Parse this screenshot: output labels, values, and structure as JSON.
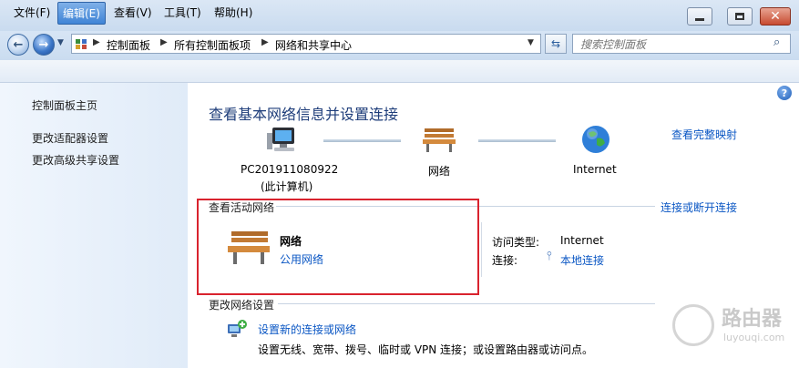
{
  "window": {
    "minimize_icon": "minimize-icon",
    "maximize_icon": "maximize-icon",
    "close_icon": "close-icon"
  },
  "address_bar": {
    "crumbs": [
      "控制面板",
      "所有控制面板项",
      "网络和共享中心"
    ]
  },
  "search": {
    "placeholder": "搜索控制面板"
  },
  "menu": [
    "文件(F)",
    "编辑(E)",
    "查看(V)",
    "工具(T)",
    "帮助(H)"
  ],
  "sidebar": {
    "items": [
      "控制面板主页",
      "更改适配器设置",
      "更改高级共享设置"
    ]
  },
  "main": {
    "title": "查看基本网络信息并设置连接",
    "view_full_map": "查看完整映射",
    "map": {
      "computer_name": "PC201911080922",
      "computer_note": "(此计算机)",
      "network": "网络",
      "internet": "Internet"
    },
    "active_section": "查看活动网络",
    "connect_link": "连接或断开连接",
    "network_name": "网络",
    "network_type": "公用网络",
    "access_type_label": "访问类型:",
    "access_type_value": "Internet",
    "connection_label": "连接:",
    "connection_value": "本地连接",
    "change_section": "更改网络设置",
    "setup_link": "设置新的连接或网络",
    "setup_desc": "设置无线、宽带、拨号、临时或 VPN 连接；或设置路由器或访问点。"
  },
  "watermark": {
    "brand": "路由器",
    "site": "luyouqi.com"
  },
  "colors": {
    "accent": "#0b57c4",
    "highlight_box": "#d9232e",
    "title": "#1e3d7a"
  }
}
